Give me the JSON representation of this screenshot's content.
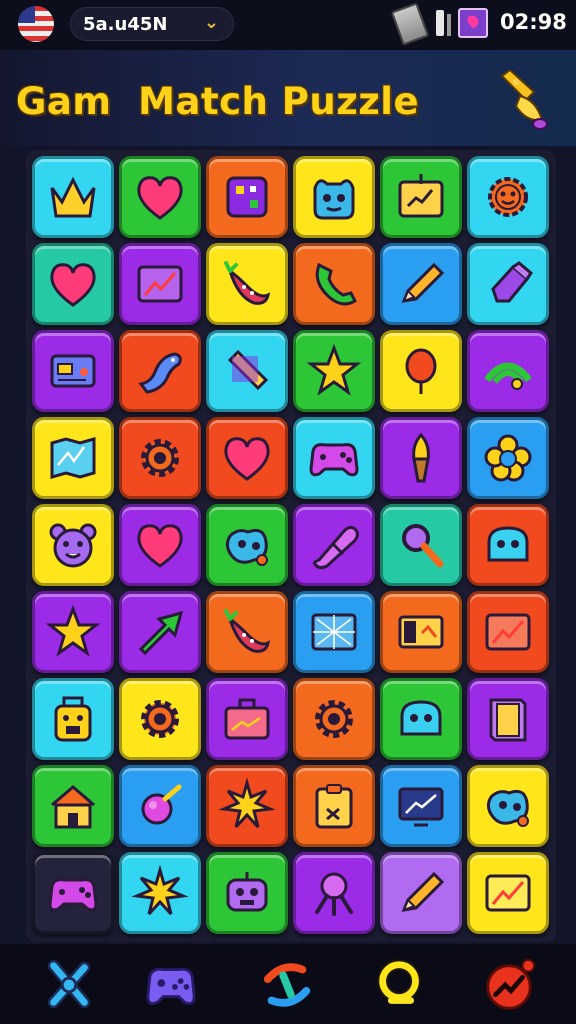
{
  "status_bar": {
    "region_label": "5a.u45N",
    "time": "02:98",
    "icons": [
      "flag-icon",
      "chevron-down-icon",
      "battery-icon",
      "signal-icon",
      "notification-icon"
    ]
  },
  "header": {
    "title": "Gam  Match Puzzle",
    "action_icon": "rocket-icon"
  },
  "colors": {
    "cyan": "#33d6f0",
    "green": "#2dc637",
    "orange": "#f36a1e",
    "yellow": "#ffe61a",
    "purple": "#9b2be6",
    "blue": "#2a9ef0",
    "red": "#f04a1e",
    "teal": "#25c9a4",
    "lavender": "#b06bf0",
    "dark": "#23233c",
    "title": "#ffd21a"
  },
  "board": {
    "rows": [
      [
        {
          "color": "cyan",
          "icon": "crown-icon"
        },
        {
          "color": "green",
          "icon": "heart-icon"
        },
        {
          "color": "orange",
          "icon": "dice-icon"
        },
        {
          "color": "yellow",
          "icon": "monster-face-icon"
        },
        {
          "color": "green",
          "icon": "folder-chart-icon"
        },
        {
          "color": "cyan",
          "icon": "smiley-gear-icon"
        }
      ],
      [
        {
          "color": "teal",
          "icon": "heart-icon"
        },
        {
          "color": "purple",
          "icon": "chart-card-icon"
        },
        {
          "color": "yellow",
          "icon": "pepper-icon"
        },
        {
          "color": "orange",
          "icon": "phone-icon"
        },
        {
          "color": "blue",
          "icon": "pencil-icon"
        },
        {
          "color": "cyan",
          "icon": "eraser-icon"
        }
      ],
      [
        {
          "color": "purple",
          "icon": "card-icon"
        },
        {
          "color": "red",
          "icon": "dragon-icon"
        },
        {
          "color": "cyan",
          "icon": "ruler-icon"
        },
        {
          "color": "green",
          "icon": "star-icon"
        },
        {
          "color": "yellow",
          "icon": "balloon-icon"
        },
        {
          "color": "purple",
          "icon": "wifi-icon"
        }
      ],
      [
        {
          "color": "yellow",
          "icon": "map-icon"
        },
        {
          "color": "red",
          "icon": "gear-icon"
        },
        {
          "color": "red",
          "icon": "heart-icon"
        },
        {
          "color": "cyan",
          "icon": "gamepad-icon"
        },
        {
          "color": "purple",
          "icon": "torch-icon"
        },
        {
          "color": "blue",
          "icon": "flower-icon"
        }
      ],
      [
        {
          "color": "yellow",
          "icon": "bear-face-icon"
        },
        {
          "color": "purple",
          "icon": "heart-icon"
        },
        {
          "color": "green",
          "icon": "robot-icon"
        },
        {
          "color": "purple",
          "icon": "capsule-icon"
        },
        {
          "color": "teal",
          "icon": "magnifier-icon"
        },
        {
          "color": "red",
          "icon": "ghost-icon"
        }
      ],
      [
        {
          "color": "purple",
          "icon": "star-icon"
        },
        {
          "color": "purple",
          "icon": "arrow-icon"
        },
        {
          "color": "orange",
          "icon": "pepper-icon"
        },
        {
          "color": "blue",
          "icon": "map-frame-icon"
        },
        {
          "color": "orange",
          "icon": "panel-icon"
        },
        {
          "color": "red",
          "icon": "chart-card-icon"
        }
      ],
      [
        {
          "color": "cyan",
          "icon": "box-face-icon"
        },
        {
          "color": "yellow",
          "icon": "gear-icon"
        },
        {
          "color": "purple",
          "icon": "briefcase-icon"
        },
        {
          "color": "orange",
          "icon": "gear-icon"
        },
        {
          "color": "green",
          "icon": "ghost-icon"
        },
        {
          "color": "purple",
          "icon": "book-icon"
        }
      ],
      [
        {
          "color": "green",
          "icon": "house-icon"
        },
        {
          "color": "blue",
          "icon": "planet-icon"
        },
        {
          "color": "red",
          "icon": "star-burst-icon"
        },
        {
          "color": "orange",
          "icon": "clipboard-icon"
        },
        {
          "color": "blue",
          "icon": "monitor-chart-icon"
        },
        {
          "color": "yellow",
          "icon": "robot-icon"
        }
      ],
      [
        {
          "color": "dark",
          "icon": "gamepad-icon"
        },
        {
          "color": "cyan",
          "icon": "star-burst-icon"
        },
        {
          "color": "green",
          "icon": "robot-face-icon"
        },
        {
          "color": "purple",
          "icon": "joystick-icon"
        },
        {
          "color": "lavender",
          "icon": "pencil-icon"
        },
        {
          "color": "yellow",
          "icon": "chart-card-icon"
        }
      ]
    ]
  },
  "nav": {
    "items": [
      {
        "icon": "tools-icon"
      },
      {
        "icon": "gamepad-icon"
      },
      {
        "icon": "swap-icon"
      },
      {
        "icon": "search-icon"
      },
      {
        "icon": "trend-icon"
      }
    ]
  }
}
